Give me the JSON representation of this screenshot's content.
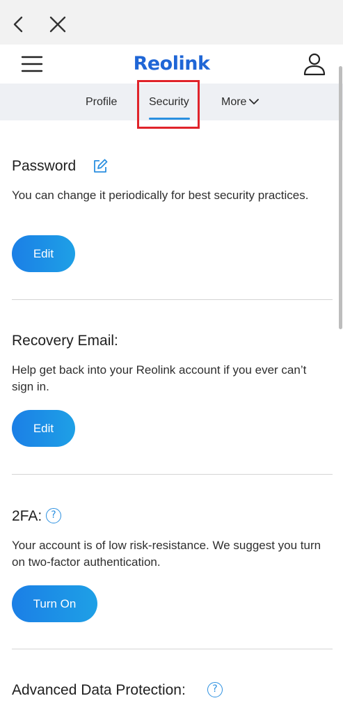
{
  "browser": {
    "back_icon": "chevron-left-icon",
    "close_icon": "close-icon"
  },
  "header": {
    "menu_icon": "hamburger-menu-icon",
    "logo_text": "Reolink",
    "user_icon": "user-account-icon",
    "brand_color": "#1f66d6"
  },
  "tabs": [
    {
      "label": "Profile",
      "active": false
    },
    {
      "label": "Security",
      "active": true
    },
    {
      "label": "More",
      "active": false
    }
  ],
  "sections": {
    "password": {
      "title": "Password",
      "title_icon": "edit-pencil-icon",
      "description": "You can change it periodically for best security practices.",
      "button_label": "Edit"
    },
    "recovery_email": {
      "title": "Recovery Email:",
      "description": "Help get back into your Reolink account if you ever can’t sign in.",
      "button_label": "Edit"
    },
    "two_fa": {
      "title": "2FA:",
      "title_icon": "help-question-icon",
      "description": "Your account is of low risk-resistance. We suggest you turn on two-factor authentication.",
      "button_label": "Turn On"
    },
    "advanced_data_protection": {
      "title": "Advanced Data Protection:",
      "title_icon": "help-question-icon"
    }
  },
  "colors": {
    "accent": "#2a8fe0",
    "button_gradient_start": "#1b7fe6",
    "button_gradient_end": "#1ea0e6",
    "highlight_box": "#e0232a"
  }
}
